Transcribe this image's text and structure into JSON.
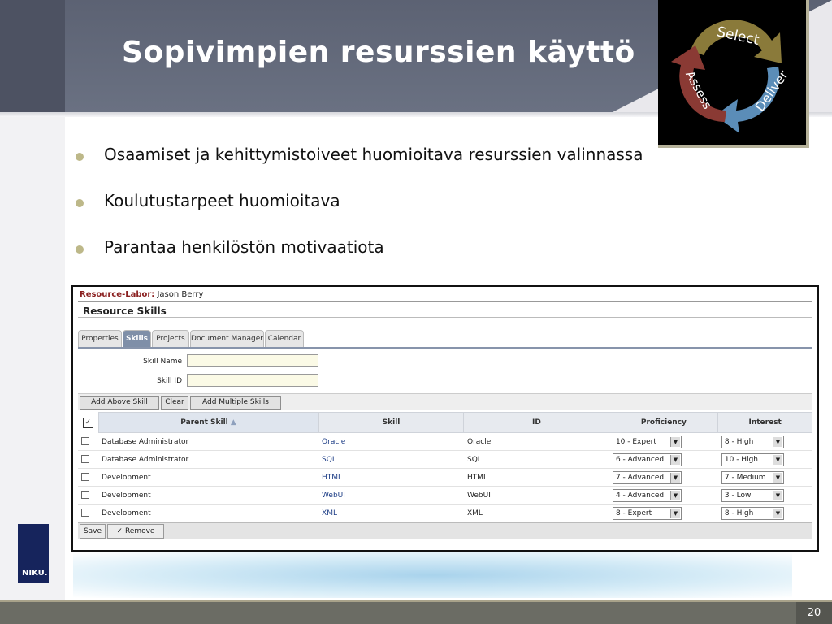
{
  "slide": {
    "title": "Sopivimpien resurssien käyttö",
    "page_number": "20",
    "brand": "NIKU.",
    "bullets": [
      "Osaamiset ja kehittymistoiveet huomioitava resurssien valinnassa",
      "Koulutustarpeet huomioitava",
      "Parantaa henkilöstön motivaatiota"
    ],
    "cycle_logo": {
      "select": "Select",
      "deliver": "Deliver",
      "assess": "Assess"
    }
  },
  "app": {
    "resource_label": "Resource-Labor:",
    "resource_name": "Jason Berry",
    "section_title": "Resource Skills",
    "tabs": [
      "Properties",
      "Skills",
      "Projects",
      "Document Manager",
      "Calendar"
    ],
    "active_tab": "Skills",
    "form": {
      "skill_name_label": "Skill Name",
      "skill_name_value": "",
      "skill_id_label": "Skill ID",
      "skill_id_value": ""
    },
    "toolbar": {
      "add_above": "Add Above Skill",
      "clear": "Clear",
      "add_multiple": "Add Multiple Skills"
    },
    "columns": {
      "parent_skill": "Parent Skill",
      "skill": "Skill",
      "id": "ID",
      "proficiency": "Proficiency",
      "interest": "Interest"
    },
    "rows": [
      {
        "parent": "Database Administrator",
        "skill": "Oracle",
        "id": "Oracle",
        "proficiency": "10 - Expert",
        "interest": "8 - High"
      },
      {
        "parent": "Database Administrator",
        "skill": "SQL",
        "id": "SQL",
        "proficiency": "6 - Advanced",
        "interest": "10 - High"
      },
      {
        "parent": "Development",
        "skill": "HTML",
        "id": "HTML",
        "proficiency": "7 - Advanced",
        "interest": "7 - Medium"
      },
      {
        "parent": "Development",
        "skill": "WebUI",
        "id": "WebUI",
        "proficiency": "4 - Advanced",
        "interest": "3 - Low"
      },
      {
        "parent": "Development",
        "skill": "XML",
        "id": "XML",
        "proficiency": "8 - Expert",
        "interest": "8 - High"
      }
    ],
    "bottom": {
      "save": "Save",
      "remove": "Remove"
    }
  },
  "colors": {
    "header": "#5c6273",
    "bullet_dot": "#bdb889",
    "link": "#1d3d86",
    "active_tab": "#7f8fa8",
    "select_arrow": "#8a7a3a",
    "deliver_arrow": "#5b8db8",
    "assess_arrow": "#8a3a34"
  }
}
